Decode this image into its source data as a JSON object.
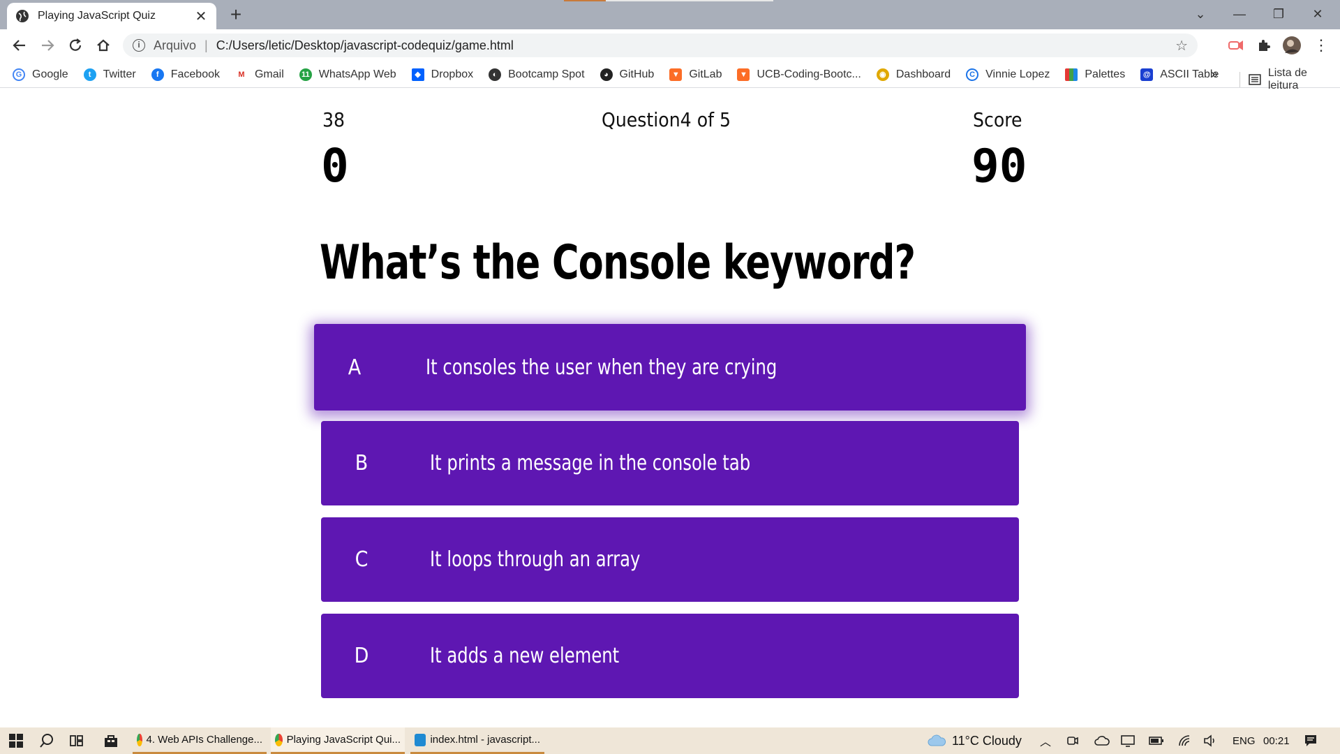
{
  "browser": {
    "tab_title": "Playing JavaScript Quiz",
    "new_tab": "+",
    "address_scheme": "Arquivo",
    "address_separator": "|",
    "address_url": "C:/Users/letic/Desktop/javascript-codequiz/game.html",
    "bookmarks": [
      "Google",
      "Twitter",
      "Facebook",
      "Gmail",
      "WhatsApp Web",
      "Dropbox",
      "Bootcamp Spot",
      "GitHub",
      "GitLab",
      "UCB-Coding-Bootc...",
      "Dashboard",
      "Vinnie Lopez",
      "Palettes",
      "ASCII Table"
    ],
    "bookmarks_more": "»",
    "reading_list": "Lista de leitura"
  },
  "quiz": {
    "timer_label": "38",
    "timer_value": "0",
    "progress_text": "Question4 of 5",
    "score_label": "Score",
    "score_value": "90",
    "question": "What’s the Console keyword?",
    "choices": [
      {
        "prefix": "A",
        "text": "It consoles the user when they are crying"
      },
      {
        "prefix": "B",
        "text": "It prints a message in the console tab"
      },
      {
        "prefix": "C",
        "text": "It loops through an array"
      },
      {
        "prefix": "D",
        "text": "It adds a new element"
      }
    ],
    "accent_color": "#5e17b2"
  },
  "taskbar": {
    "apps": [
      "4. Web APIs Challenge...",
      "Playing JavaScript Qui...",
      "index.html - javascript..."
    ],
    "weather": "11°C  Cloudy",
    "language": "ENG",
    "time": "00:21"
  }
}
